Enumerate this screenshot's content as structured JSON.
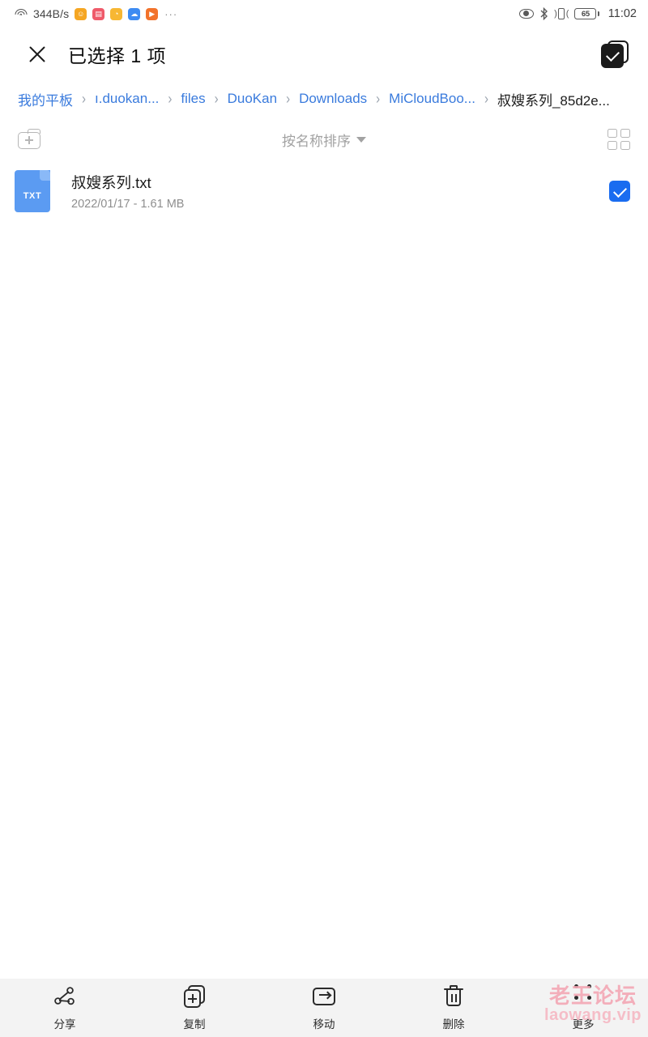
{
  "statusbar": {
    "network_speed": "344B/s",
    "wifi_icon": "wifi-icon",
    "app_icons": [
      {
        "name": "app-icon-smiley",
        "glyph": "☺",
        "color": "#f5a623"
      },
      {
        "name": "app-icon-book",
        "glyph": "▤",
        "color": "#ef5a6a"
      },
      {
        "name": "app-icon-cup",
        "glyph": "◔",
        "color": "#f7b733"
      },
      {
        "name": "app-icon-cloud",
        "glyph": "☁",
        "color": "#3d8bf2"
      },
      {
        "name": "app-icon-play",
        "glyph": "▶",
        "color": "#f2722b"
      }
    ],
    "overflow": "···",
    "battery_level": "65",
    "time": "11:02"
  },
  "titlebar": {
    "close_label": "close",
    "title": "已选择 1 项",
    "select_all_label": "select-all"
  },
  "breadcrumb": {
    "separator": "›",
    "items": [
      {
        "label": "我的平板",
        "current": false
      },
      {
        "label": "ı.duokan...",
        "current": false
      },
      {
        "label": "files",
        "current": false
      },
      {
        "label": "DuoKan",
        "current": false
      },
      {
        "label": "Downloads",
        "current": false
      },
      {
        "label": "MiCloudBoo...",
        "current": false
      },
      {
        "label": "叔嫂系列_85d2e...",
        "current": true
      }
    ]
  },
  "sortbar": {
    "new_folder_label": "new-folder",
    "sort_label": "按名称排序",
    "caret": "▼",
    "grid_label": "grid-view"
  },
  "files": [
    {
      "name": "叔嫂系列.txt",
      "meta": "2022/01/17 - 1.61 MB",
      "type_label": "TXT",
      "selected": true
    }
  ],
  "bottombar": {
    "items": [
      {
        "label": "分享",
        "icon": "share-icon"
      },
      {
        "label": "复制",
        "icon": "copy-icon"
      },
      {
        "label": "移动",
        "icon": "move-icon"
      },
      {
        "label": "删除",
        "icon": "trash-icon"
      },
      {
        "label": "更多",
        "icon": "more-icon"
      }
    ]
  },
  "watermark": {
    "main": "老王论坛",
    "sub": "laowang.vip"
  },
  "colors": {
    "accent_blue": "#3a7bdd",
    "checkbox_blue": "#1a6cf0",
    "txt_icon_blue": "#5b9bf2",
    "toolbar_bg": "#f3f3f3",
    "watermark_pink": "#f4a9b6"
  }
}
